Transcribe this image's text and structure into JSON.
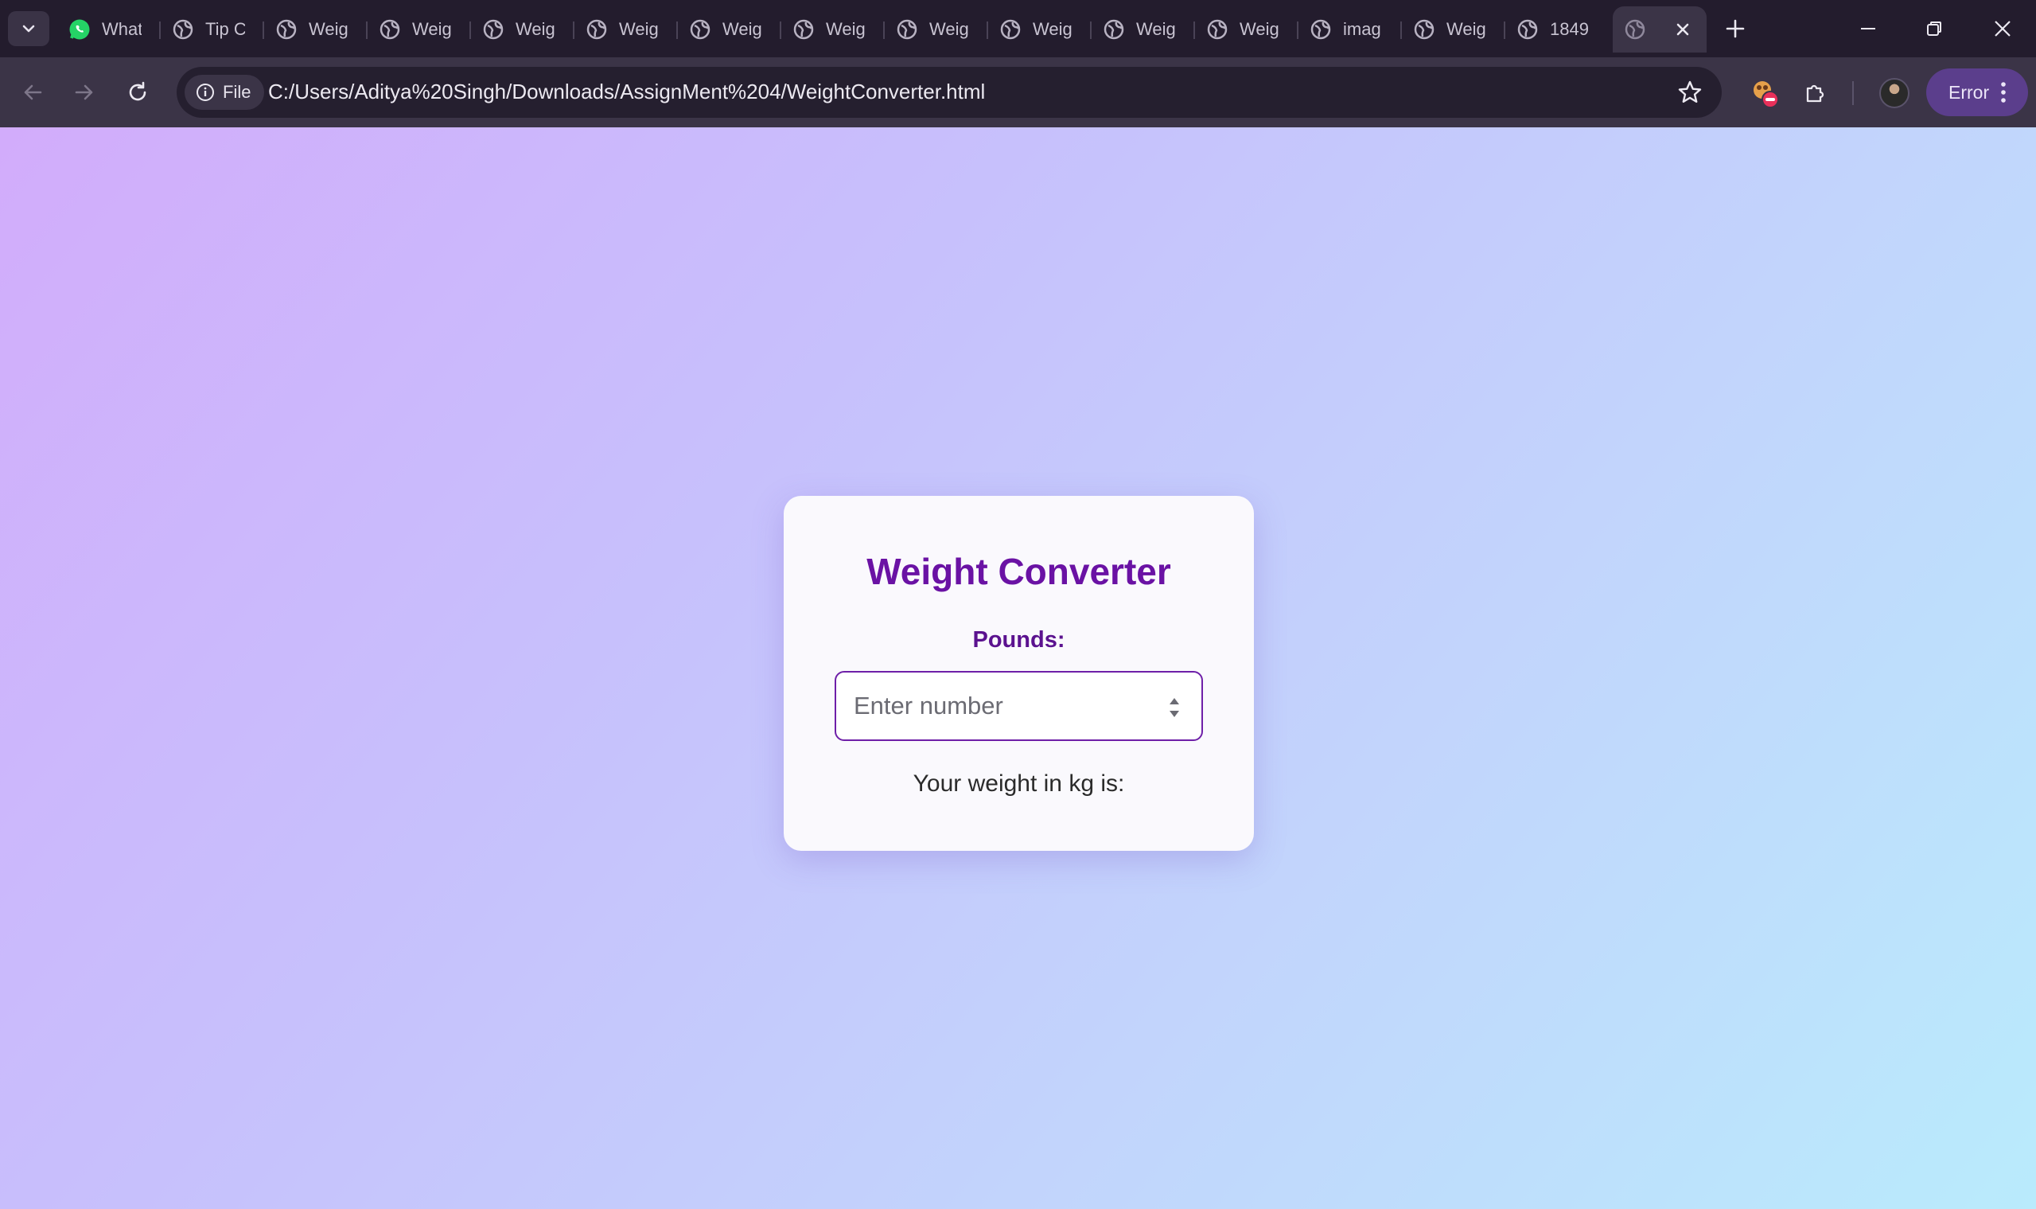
{
  "browser": {
    "tabs": [
      {
        "label": "What",
        "icon": "whatsapp-icon"
      },
      {
        "label": "Tip C",
        "icon": "globe-icon"
      },
      {
        "label": "Weig",
        "icon": "globe-icon"
      },
      {
        "label": "Weig",
        "icon": "globe-icon"
      },
      {
        "label": "Weig",
        "icon": "globe-icon"
      },
      {
        "label": "Weig",
        "icon": "globe-icon"
      },
      {
        "label": "Weig",
        "icon": "globe-icon"
      },
      {
        "label": "Weig",
        "icon": "globe-icon"
      },
      {
        "label": "Weig",
        "icon": "globe-icon"
      },
      {
        "label": "Weig",
        "icon": "globe-icon"
      },
      {
        "label": "Weig",
        "icon": "globe-icon"
      },
      {
        "label": "Weig",
        "icon": "globe-icon"
      },
      {
        "label": "imag",
        "icon": "globe-icon"
      },
      {
        "label": "Weig",
        "icon": "globe-icon"
      },
      {
        "label": "1849",
        "icon": "globe-icon"
      }
    ],
    "active_tab": {
      "label": "",
      "icon": "globe-icon"
    },
    "site_info_label": "File",
    "url": "C:/Users/Aditya%20Singh/Downloads/AssignMent%204/WeightConverter.html",
    "profile_status": "Error"
  },
  "app": {
    "title": "Weight Converter",
    "input_label": "Pounds:",
    "input_placeholder": "Enter number",
    "input_value": "",
    "result_label": "Your weight in kg is:"
  },
  "colors": {
    "accent": "#6a12a4",
    "label": "#5b128f",
    "card_bg": "#faf9fd",
    "gradient_start": "#d2acfb",
    "gradient_end": "#b9ebfc"
  }
}
